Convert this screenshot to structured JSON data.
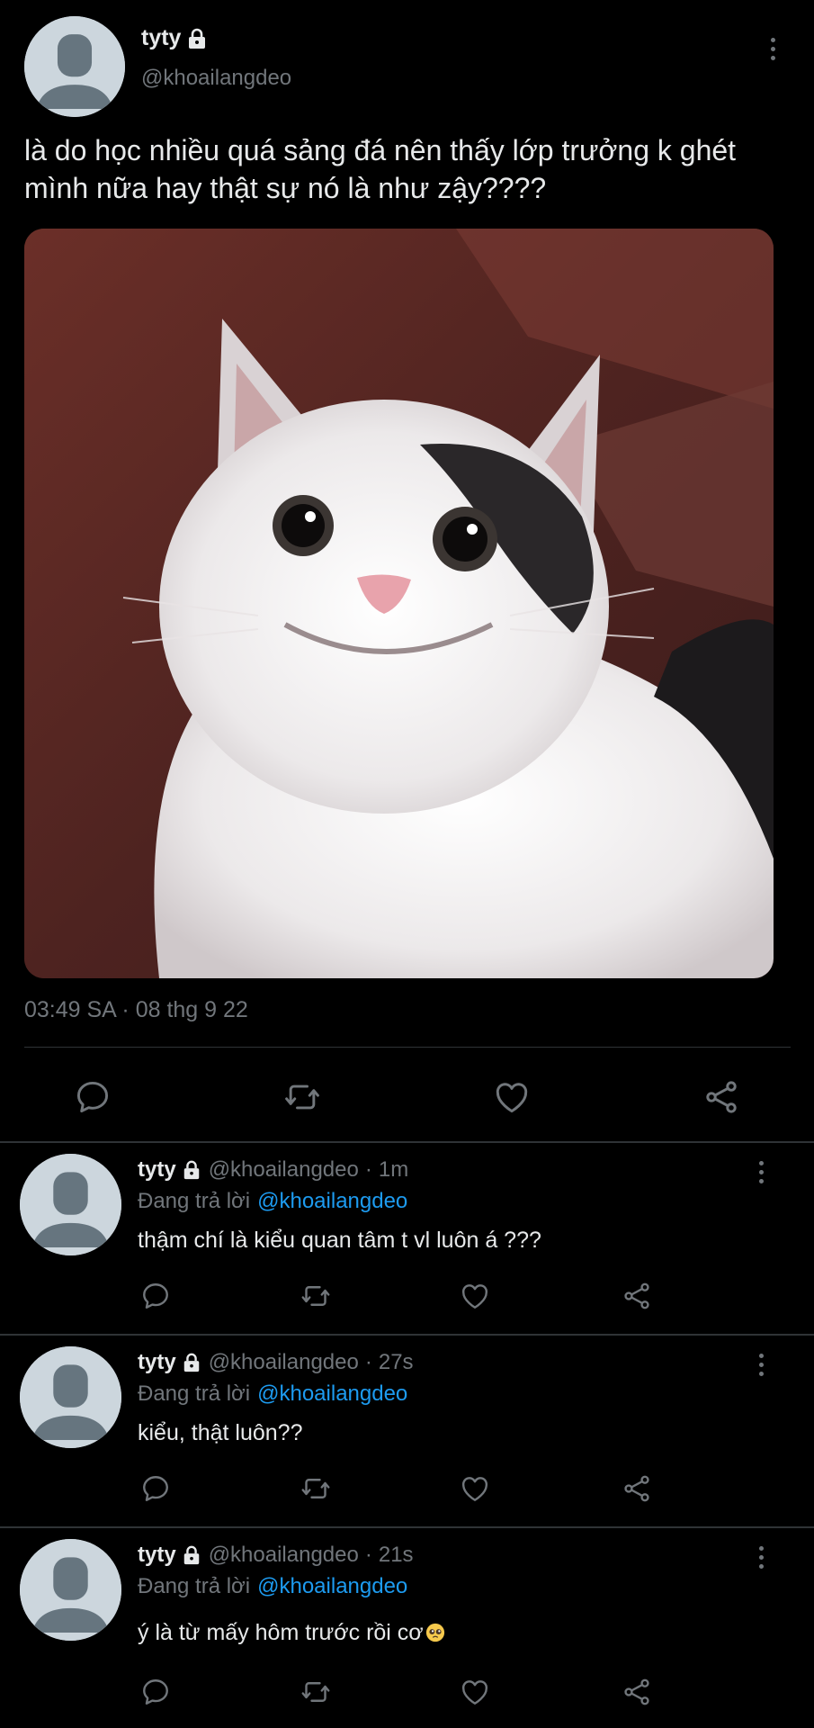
{
  "tweet": {
    "display_name": "tyty",
    "handle": "@khoailangdeo",
    "text": "là do học nhiều quá sảng đá nên thấy lớp trưởng k ghét mình nữa hay thật sự nó là như zậy????",
    "timestamp": "03:49 SA · 08 thg 9 22",
    "media_icon": "cat-photo",
    "actions": [
      "reply-icon",
      "retweet-icon",
      "like-icon",
      "share-icon"
    ]
  },
  "replies": [
    {
      "display_name": "tyty",
      "handle": "@khoailangdeo",
      "separator": "·",
      "time": "1m",
      "replying_label": "Đang trả lời",
      "replying_to": "@khoailangdeo",
      "text": "thậm chí là kiểu quan tâm t vl luôn á ???"
    },
    {
      "display_name": "tyty",
      "handle": "@khoailangdeo",
      "separator": "·",
      "time": "27s",
      "replying_label": "Đang trả lời",
      "replying_to": "@khoailangdeo",
      "text": "kiểu, thật luôn??"
    },
    {
      "display_name": "tyty",
      "handle": "@khoailangdeo",
      "separator": "·",
      "time": "21s",
      "replying_label": "Đang trả lời",
      "replying_to": "@khoailangdeo",
      "text": "ý là từ mấy hôm trước rồi cơ",
      "trailing_emoji": "pleading-face-emoji"
    }
  ],
  "colors": {
    "background": "#000000",
    "text_primary": "#e7e9ea",
    "text_secondary": "#71767b",
    "accent": "#1d9bf0",
    "divider": "#2f3336"
  }
}
